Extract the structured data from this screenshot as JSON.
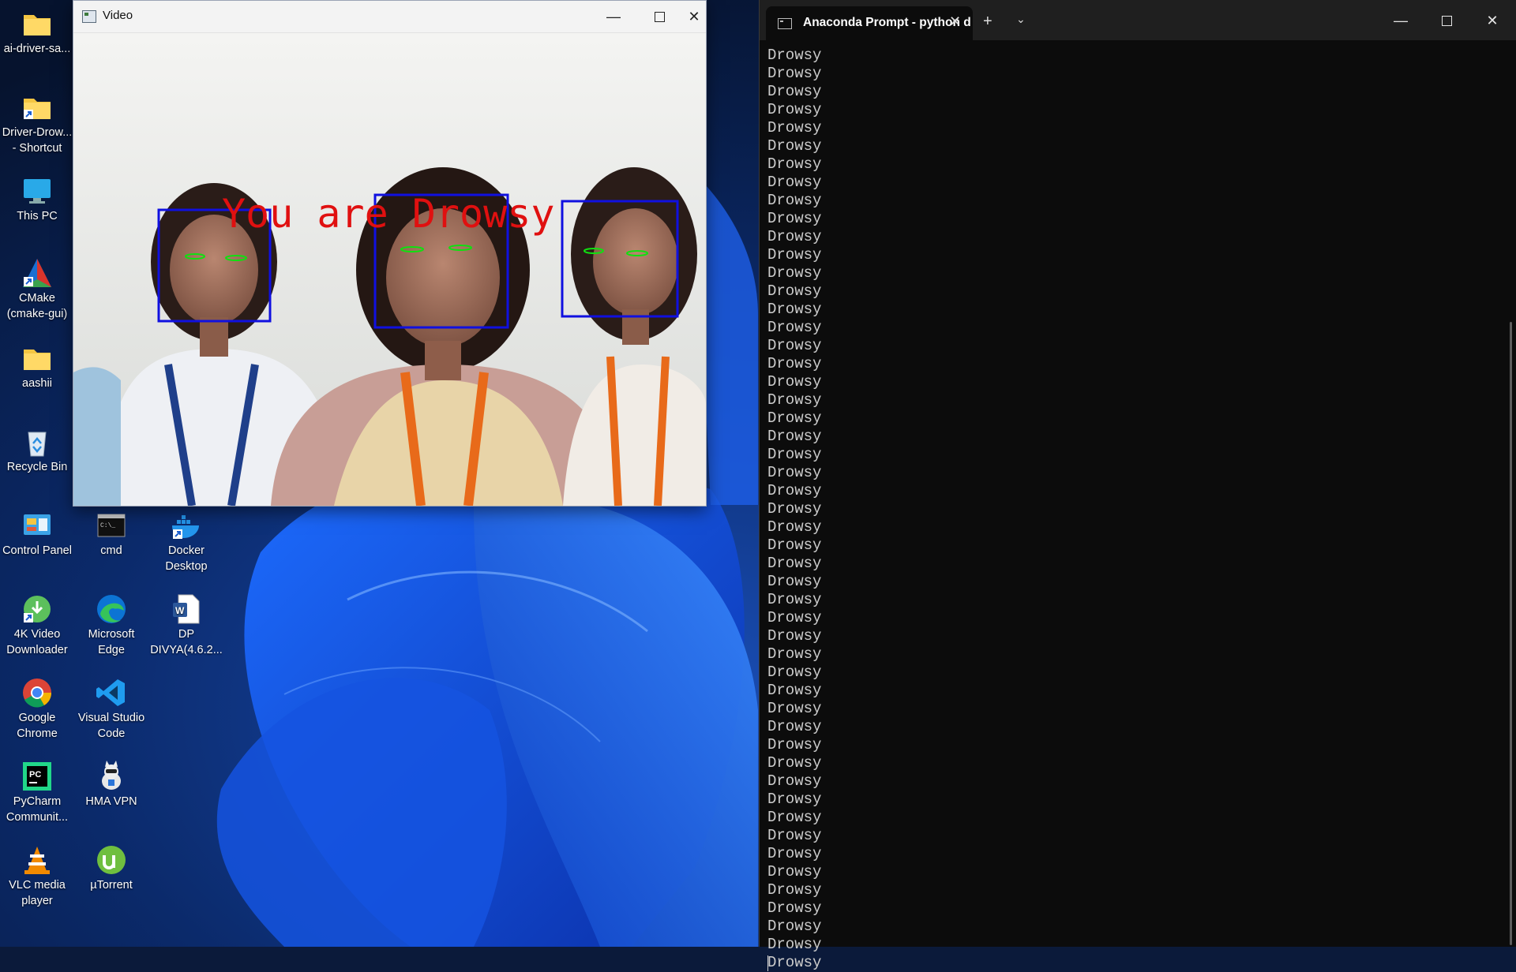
{
  "desktop": {
    "icons": [
      {
        "label": "ai-driver-sa...",
        "icon": "folder-icon"
      },
      {
        "label": "Driver-Drow...\n- Shortcut",
        "icon": "folder-shortcut-icon"
      },
      {
        "label": "This PC",
        "icon": "monitor-icon"
      },
      {
        "label": "CMake\n(cmake-gui)",
        "icon": "cmake-icon"
      },
      {
        "label": "aashii",
        "icon": "folder-icon"
      },
      {
        "label": "Recycle Bin",
        "icon": "recycle-bin-icon"
      },
      {
        "label": "Control Panel",
        "icon": "control-panel-icon"
      },
      {
        "label": "cmd",
        "icon": "cmd-icon"
      },
      {
        "label": "Docker\nDesktop",
        "icon": "docker-icon"
      },
      {
        "label": "4K Video\nDownloader",
        "icon": "video-downloader-icon"
      },
      {
        "label": "Microsoft\nEdge",
        "icon": "edge-icon"
      },
      {
        "label": "DP\nDIVYA(4.6.2...",
        "icon": "word-doc-icon"
      },
      {
        "label": "Google\nChrome",
        "icon": "chrome-icon"
      },
      {
        "label": "Visual Studio\nCode",
        "icon": "vscode-icon"
      },
      {
        "label": "PyCharm\nCommunit...",
        "icon": "pycharm-icon"
      },
      {
        "label": "HMA VPN",
        "icon": "vpn-icon"
      },
      {
        "label": "VLC media\nplayer",
        "icon": "vlc-icon"
      },
      {
        "label": "µTorrent",
        "icon": "utorrent-icon"
      }
    ]
  },
  "video_window": {
    "title": "Video",
    "overlay_text": "You are Drowsy",
    "overlay_color": "#e01010",
    "box_color": "#1010e0",
    "eye_color": "#10e010"
  },
  "terminal": {
    "tab_title": "Anaconda Prompt - python  d",
    "new_tab": "+",
    "lines": [
      "Drowsy",
      "Drowsy",
      "Drowsy",
      "Drowsy",
      "Drowsy",
      "Drowsy",
      "Drowsy",
      "Drowsy",
      "Drowsy",
      "Drowsy",
      "Drowsy",
      "Drowsy",
      "Drowsy",
      "Drowsy",
      "Drowsy",
      "Drowsy",
      "Drowsy",
      "Drowsy",
      "Drowsy",
      "Drowsy",
      "Drowsy",
      "Drowsy",
      "Drowsy",
      "Drowsy",
      "Drowsy",
      "Drowsy",
      "Drowsy",
      "Drowsy",
      "Drowsy",
      "Drowsy",
      "Drowsy",
      "Drowsy",
      "Drowsy",
      "Drowsy",
      "Drowsy",
      "Drowsy",
      "Drowsy",
      "Drowsy",
      "Drowsy",
      "Drowsy",
      "Drowsy",
      "Drowsy",
      "Drowsy",
      "Drowsy",
      "Drowsy",
      "Drowsy",
      "Drowsy",
      "Drowsy",
      "Drowsy",
      "Drowsy",
      "Drowsy"
    ]
  }
}
